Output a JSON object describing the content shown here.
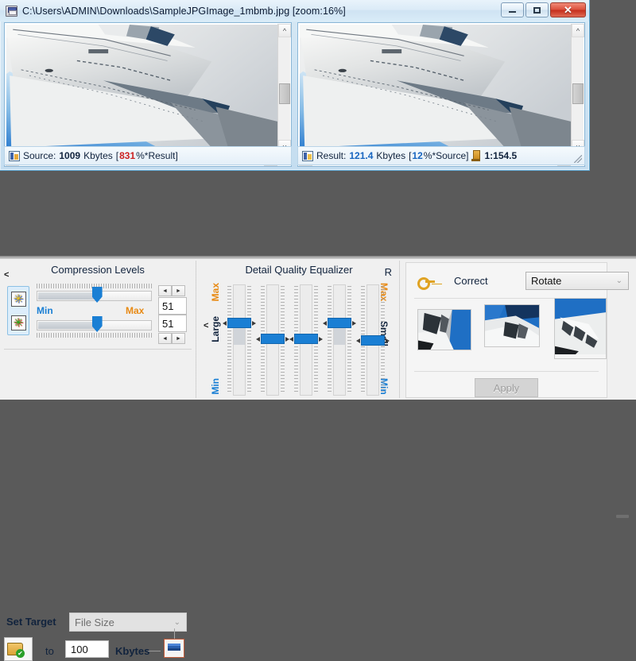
{
  "window": {
    "title": "C:\\Users\\ADMIN\\Downloads\\SampleJPGImage_1mbmb.jpg  [zoom:16%]",
    "icon": "image-file-icon",
    "minimize_label": "",
    "maximize_label": "",
    "close_label": "✕"
  },
  "panes": {
    "left": {
      "name": "source-image",
      "scroll_up": "^",
      "scroll_down": "v",
      "scroll_left": "‹",
      "scroll_right": "›"
    },
    "right": {
      "name": "result-image",
      "scroll_up": "^",
      "scroll_down": "v",
      "scroll_left": "‹",
      "scroll_right": "›"
    }
  },
  "status": {
    "source": {
      "label": "Source:",
      "value": "1009",
      "unit": "Kbytes",
      "bracket_open": "[",
      "percent": "831",
      "percent_suffix": "%*Result]"
    },
    "result": {
      "label": "Result:",
      "value": "121.4",
      "unit": "Kbytes",
      "bracket_open": "[",
      "percent": "12",
      "percent_suffix": "%*Source]",
      "ratio": "1:154.5"
    }
  },
  "compression": {
    "title": "Compression Levels",
    "collapse_chevron": "<",
    "min_label": "Min",
    "max_label": "Max",
    "slider_top_value": "51",
    "slider_bottom_value": "51",
    "spin_left": "◄",
    "spin_right": "►",
    "set_target_label": "Set Target",
    "target_mode": "File Size",
    "target_caret": "⌄",
    "to_label": "to",
    "target_value": "100",
    "target_unit": "Kbytes"
  },
  "equalizer": {
    "title": "Detail Quality Equalizer",
    "r_label": "R",
    "collapse_chevron": "<",
    "left_top": "Max",
    "left_mid": "Large",
    "left_bottom": "Min",
    "right_top": "Max",
    "right_mid": "Small",
    "right_bottom": "Min",
    "bands": [
      {
        "name": "band-1",
        "position_pct": 58
      },
      {
        "name": "band-2",
        "position_pct": 45
      },
      {
        "name": "band-3",
        "position_pct": 45
      },
      {
        "name": "band-4",
        "position_pct": 58
      },
      {
        "name": "band-5",
        "position_pct": 44
      }
    ]
  },
  "correct": {
    "label": "Correct",
    "mode": "Rotate",
    "caret": "⌄",
    "apply_label": "Apply",
    "thumbnails": [
      {
        "name": "rotate-option-1",
        "rotation": "90"
      },
      {
        "name": "rotate-option-2",
        "rotation": "180"
      },
      {
        "name": "rotate-option-3",
        "rotation": "270"
      }
    ]
  },
  "colors": {
    "accent_blue": "#1a7fd4",
    "label_orange": "#e88a14",
    "alert_red": "#cc2121",
    "value_blue": "#1765c0",
    "desktop_gray": "#5a5a5a"
  }
}
